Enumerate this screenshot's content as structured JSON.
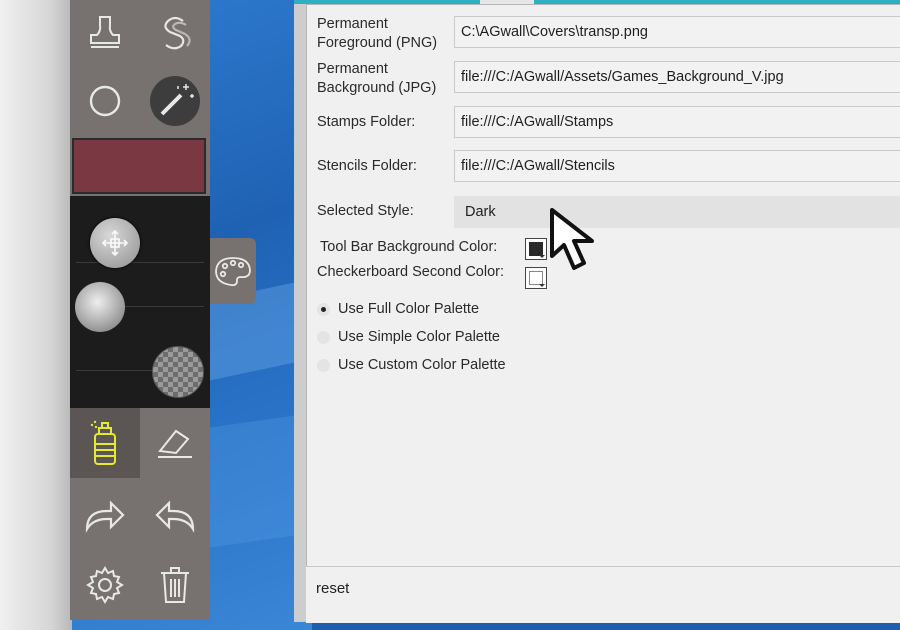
{
  "toolbar": {
    "tools": [
      "stamp-icon",
      "stencil-s-icon",
      "circle-icon",
      "magic-wand-icon",
      "move-icon",
      "soft-brush-icon",
      "transparent-brush-icon",
      "spray-can-icon",
      "eraser-icon",
      "redo-icon",
      "undo-icon",
      "gear-icon",
      "trash-icon"
    ],
    "swatch_color": "#7a3843",
    "accent_color": "#e4ea2e"
  },
  "palette_tab": {
    "icon": "palette-icon"
  },
  "settings": {
    "foreground": {
      "label": "Permanent\nForeground (PNG)",
      "value": "C:\\AGwall\\Covers\\transp.png"
    },
    "background": {
      "label": "Permanent\nBackground (JPG)",
      "value": "file:///C:/AGwall/Assets/Games_Background_V.jpg"
    },
    "stamps": {
      "label": "Stamps Folder:",
      "value": "file:///C:/AGwall/Stamps"
    },
    "stencils": {
      "label": "Stencils Folder:",
      "value": "file:///C:/AGwall/Stencils"
    },
    "style": {
      "label": "Selected Style:",
      "value": "Dark"
    },
    "toolbar_bg": {
      "label": "Tool Bar Background Color:",
      "color": "#2a2a2a"
    },
    "checker": {
      "label": "Checkerboard Second Color:",
      "color": "#ffffff"
    },
    "palette_options": [
      {
        "label": "Use Full Color Palette",
        "selected": true
      },
      {
        "label": "Use Simple Color Palette",
        "selected": false
      },
      {
        "label": "Use Custom Color Palette",
        "selected": false
      }
    ],
    "reset_label": "reset"
  }
}
